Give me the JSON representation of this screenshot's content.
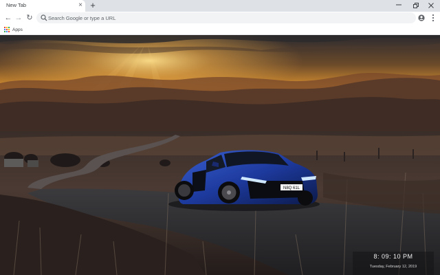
{
  "tab": {
    "title": "New Tab",
    "close_glyph": "×"
  },
  "new_tab_glyph": "+",
  "window_controls": {
    "minimize": "minimize-icon",
    "restore": "restore-icon",
    "close": "close-icon"
  },
  "toolbar": {
    "back": "←",
    "forward": "→",
    "reload": "↻",
    "omnibox_placeholder": "Search Google or type a URL",
    "bookmark_star": "☆"
  },
  "bookmarks": {
    "apps_label": "Apps",
    "apps_colors": [
      "#ea4335",
      "#fbbc05",
      "#34a853",
      "#4285f4",
      "#ea4335",
      "#fbbc05",
      "#34a853",
      "#4285f4",
      "#ea4335"
    ]
  },
  "wallpaper": {
    "description_icon": "sports-car-sunset-wallpaper",
    "license_plate": "N8Q 61L",
    "colors": {
      "sky_top": "#2b2a2e",
      "sun": "#f7c25a",
      "car": "#1d3a9e"
    }
  },
  "clock": {
    "time": "8: 09: 10 PM",
    "date": "Tuesday, February 12, 2019"
  }
}
